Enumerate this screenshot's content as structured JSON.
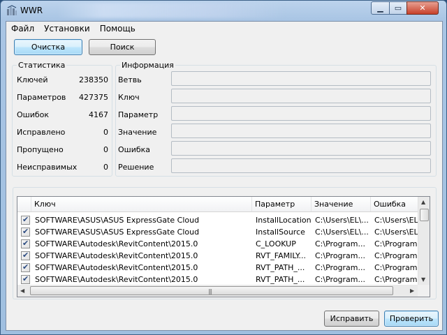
{
  "window": {
    "title": "WWR"
  },
  "menu": [
    "Файл",
    "Установки",
    "Помощь"
  ],
  "toolbar": {
    "clean_label": "Очистка",
    "search_label": "Поиск"
  },
  "stats": {
    "title": "Статистика",
    "rows": [
      {
        "label": "Ключей",
        "value": "238350"
      },
      {
        "label": "Параметров",
        "value": "427375"
      },
      {
        "label": "Ошибок",
        "value": "4167"
      },
      {
        "label": "Исправлено",
        "value": "0"
      },
      {
        "label": "Пропущено",
        "value": "0"
      },
      {
        "label": "Неисправимых",
        "value": "0"
      }
    ]
  },
  "info": {
    "title": "Информация",
    "fields": [
      {
        "label": "Ветвь",
        "value": ""
      },
      {
        "label": "Ключ",
        "value": ""
      },
      {
        "label": "Параметр",
        "value": ""
      },
      {
        "label": "Значение",
        "value": ""
      },
      {
        "label": "Ошибка",
        "value": ""
      },
      {
        "label": "Решение",
        "value": ""
      }
    ]
  },
  "list": {
    "columns": [
      "Ключ",
      "Параметр",
      "Значение",
      "Ошибка"
    ],
    "rows": [
      {
        "checked": true,
        "key": "SOFTWARE\\ASUS\\ASUS ExpressGate Cloud",
        "param": "InstallLocation",
        "value": "C:\\Users\\EL\\...",
        "error": "C:\\Users\\EL\\..."
      },
      {
        "checked": true,
        "key": "SOFTWARE\\ASUS\\ASUS ExpressGate Cloud",
        "param": "InstallSource",
        "value": "C:\\Users\\EL\\...",
        "error": "C:\\Users\\EL\\..."
      },
      {
        "checked": true,
        "key": "SOFTWARE\\Autodesk\\RevitContent\\2015.0",
        "param": "C_LOOKUP",
        "value": "C:\\Program...",
        "error": "C:\\Program..."
      },
      {
        "checked": true,
        "key": "SOFTWARE\\Autodesk\\RevitContent\\2015.0",
        "param": "RVT_FAMILY...",
        "value": "C:\\Program...",
        "error": "C:\\Program..."
      },
      {
        "checked": true,
        "key": "SOFTWARE\\Autodesk\\RevitContent\\2015.0",
        "param": "RVT_PATH_...",
        "value": "C:\\Program...",
        "error": "C:\\Program..."
      },
      {
        "checked": true,
        "key": "SOFTWARE\\Autodesk\\RevitContent\\2015.0",
        "param": "RVT_PATH_...",
        "value": "C:\\Program...",
        "error": "C:\\Program..."
      }
    ]
  },
  "footer": {
    "fix_label": "Исправить",
    "check_label": "Проверить"
  },
  "icons": {
    "app": "app-icon",
    "minimize": "minimize-icon",
    "maximize": "maximize-icon",
    "close": "close-icon"
  },
  "colors": {
    "titlebar": "#a9c5e4",
    "close": "#c7412a",
    "active_button": "#bee6fd"
  }
}
